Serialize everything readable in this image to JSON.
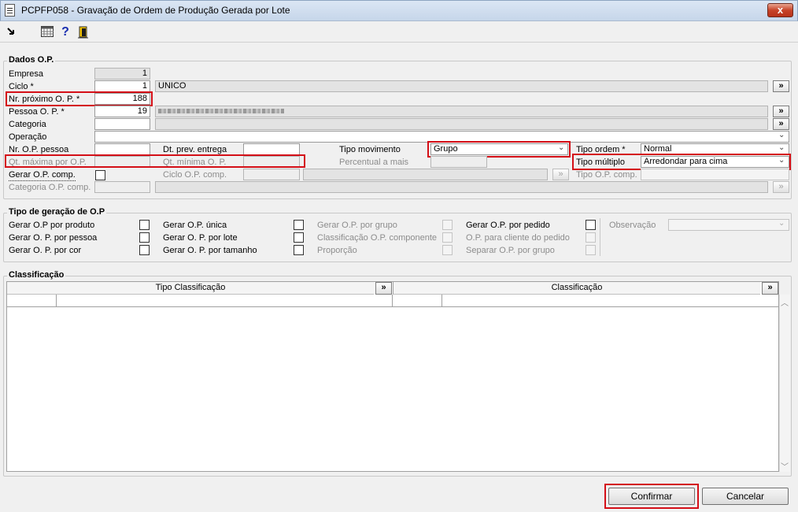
{
  "window": {
    "title": "PCPFP058 - Gravação de Ordem de Produção Gerada por Lote",
    "close_glyph": "x"
  },
  "toolbar": {
    "icons": [
      "exit-arrow-icon",
      "calendar-grid-icon",
      "help-icon",
      "door-exit-icon"
    ]
  },
  "dados_op": {
    "title": "Dados O.P.",
    "empresa_label": "Empresa",
    "empresa_value": "1",
    "ciclo_label": "Ciclo *",
    "ciclo_value": "1",
    "ciclo_desc": "UNICO",
    "nr_proximo_label": "Nr. próximo O. P. *",
    "nr_proximo_value": "188",
    "pessoa_label": "Pessoa O. P. *",
    "pessoa_value": "19",
    "categoria_label": "Categoria",
    "operacao_label": "Operação",
    "nr_op_pessoa_label": "Nr. O.P. pessoa",
    "dt_prev_label": "Dt. prev. entrega",
    "tipo_mov_label": "Tipo movimento",
    "tipo_mov_value": "Grupo",
    "tipo_ordem_label": "Tipo ordem *",
    "tipo_ordem_value": "Normal",
    "qt_max_label": "Qt. máxima por O.P.",
    "qt_min_label": "Qt. mínima O. P.",
    "percentual_label": "Percentual a mais",
    "tipo_multiplo_label": "Tipo múltiplo",
    "tipo_multiplo_value": "Arredondar para cima",
    "gerar_comp_label": "Gerar O.P. comp.",
    "ciclo_op_comp_label": "Ciclo O.P. comp.",
    "tipo_op_comp_label": "Tipo O.P. comp.",
    "categoria_op_comp_label": "Categoria O.P. comp.",
    "lookup_glyph": "»",
    "dropdown_glyph": "⌄"
  },
  "tipo_geracao": {
    "title": "Tipo de geração de O.P",
    "options": {
      "por_produto": "Gerar O.P por produto",
      "por_pessoa": "Gerar O. P. por pessoa",
      "por_cor": "Gerar O. P. por cor",
      "unica": "Gerar O.P. única",
      "por_lote": "Gerar O. P. por lote",
      "por_tamanho": "Gerar O. P. por tamanho",
      "por_grupo": "Gerar O.P. por grupo",
      "classificacao_comp": "Classificação O.P. componente",
      "proporcao": "Proporção",
      "por_pedido": "Gerar O.P. por pedido",
      "cliente_pedido": "O.P. para cliente do pedido",
      "separar_grupo": "Separar  O.P. por grupo"
    },
    "observacao_label": "Observação"
  },
  "classificacao": {
    "title": "Classificação",
    "columns": [
      "Tipo Classificação",
      "Classificação"
    ],
    "lookup_glyph": "»"
  },
  "actions": {
    "confirm": "Confirmar",
    "cancel": "Cancelar"
  },
  "colors": {
    "highlight": "#d40f17"
  }
}
